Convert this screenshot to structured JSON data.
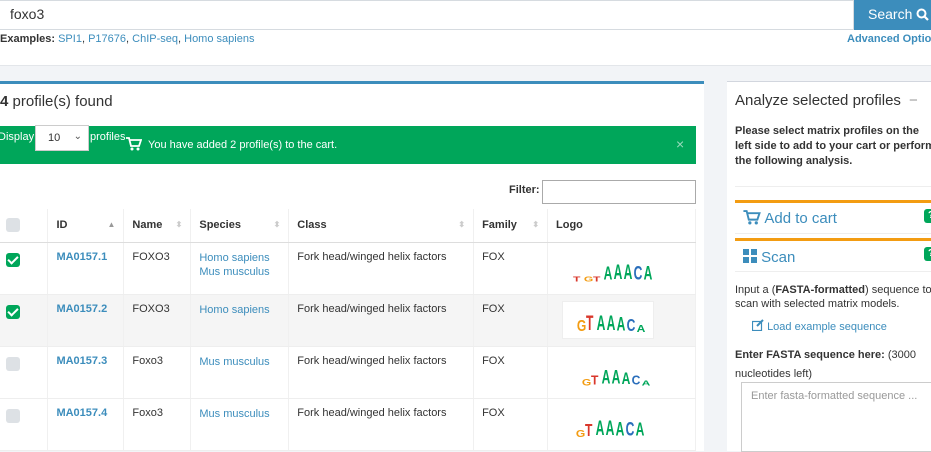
{
  "search": {
    "value": "foxo3",
    "button_label": "Search"
  },
  "examples": {
    "label": "Examples:",
    "items": [
      "SPI1",
      "P17676",
      "ChIP-seq",
      "Homo sapiens"
    ]
  },
  "advanced_label": "Advanced Options",
  "results": {
    "found_count": "4",
    "found_text": " profile(s) found",
    "display_label": "Display",
    "display_value": "10",
    "profiles_label": "profiles",
    "alert": {
      "message": "You have added 2 profile(s) to the cart.",
      "close": "×",
      "color": "#00a65a"
    },
    "filter_label": "Filter:",
    "columns": [
      "ID",
      "Name",
      "Species",
      "Class",
      "Family",
      "Logo"
    ],
    "rows": [
      {
        "checked": true,
        "id": "MA0157.1",
        "name": "FOXO3",
        "species": [
          "Homo sapiens",
          "Mus musculus"
        ],
        "class": "Fork head/winged helix factors",
        "family": "FOX",
        "logo": "TGTAAACA"
      },
      {
        "checked": true,
        "id": "MA0157.2",
        "name": "FOXO3",
        "species": [
          "Homo sapiens"
        ],
        "class": "Fork head/winged helix factors",
        "family": "FOX",
        "logo": "GTAAACA"
      },
      {
        "checked": false,
        "id": "MA0157.3",
        "name": "Foxo3",
        "species": [
          "Mus musculus"
        ],
        "class": "Fork head/winged helix factors",
        "family": "FOX",
        "logo": "GTAAACA"
      },
      {
        "checked": false,
        "id": "MA0157.4",
        "name": "Foxo3",
        "species": [
          "Mus musculus"
        ],
        "class": "Fork head/winged helix factors",
        "family": "FOX",
        "logo": "GTAAACA"
      }
    ]
  },
  "sidebar": {
    "title": "Analyze selected profiles",
    "note": "Please select matrix profiles on the left side to add to your cart or perform the following analysis.",
    "cart_title": "Add to cart",
    "scan_title": "Scan",
    "help_label": "?",
    "scan_desc_1": "Input a (",
    "scan_desc_bold": "FASTA-formatted",
    "scan_desc_2": ") sequence to scan with selected matrix models.",
    "load_example": "Load example sequence",
    "fasta_label_bold": "Enter FASTA sequence here:",
    "fasta_label_rest": " (3000 nucleotides left)",
    "fasta_placeholder": "Enter fasta-formatted sequence ..."
  },
  "colors": {
    "primary": "#3c8dbc",
    "success": "#00a65a",
    "warning": "#f39c12",
    "A": "#00a65a",
    "C": "#2a6ebb",
    "G": "#f39c12",
    "T": "#d9372b"
  }
}
